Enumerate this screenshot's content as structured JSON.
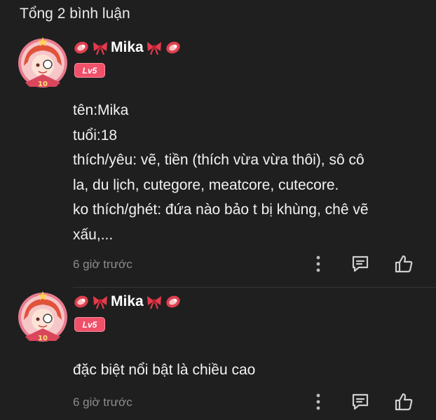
{
  "header": {
    "comment_count": "Tổng 2 bình luận"
  },
  "comments": [
    {
      "username": "Mika",
      "level": "Lv5",
      "lines": [
        "tên:Mika",
        "tuổi:18",
        "thích/yêu: vẽ, tiền (thích vừa vừa thôi), sô cô",
        "la, du lịch, cutegore, meatcore, cutecore.",
        "ko thích/ghét: đứa nào bảo t bị khùng, chê vẽ",
        "xấu,..."
      ],
      "time": "6 giờ trước"
    },
    {
      "username": "Mika",
      "level": "Lv5",
      "lines": [
        "đặc biệt nổi bật là chiều cao"
      ],
      "time": "6 giờ trước"
    }
  ],
  "colors": {
    "background": "#1f1f1f",
    "level_badge": "#f0506a",
    "muted_text": "#8c8c8c"
  },
  "icons": {
    "name_decorations": [
      "meat-icon",
      "bow-icon",
      "bow-icon",
      "meat-icon"
    ],
    "actions": [
      "more-vertical-icon",
      "reply-icon",
      "like-icon"
    ]
  }
}
